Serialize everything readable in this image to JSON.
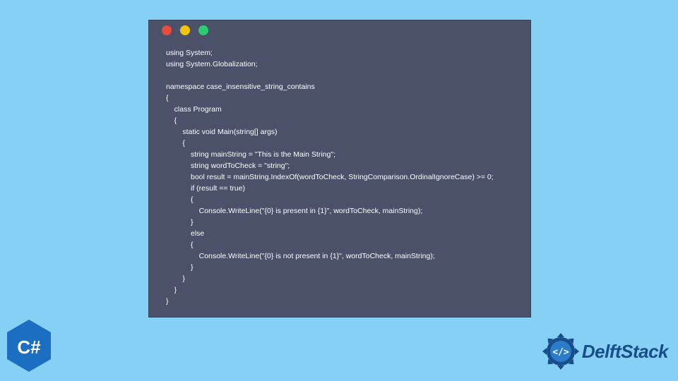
{
  "window": {
    "dots": {
      "red": "#e74c3c",
      "yellow": "#f1c40f",
      "green": "#2ecc71"
    }
  },
  "code": "using System;\nusing System.Globalization;\n\nnamespace case_insensitive_string_contains\n{\n    class Program\n    {\n        static void Main(string[] args)\n        {\n            string mainString = \"This is the Main String\";\n            string wordToCheck = \"string\";\n            bool result = mainString.IndexOf(wordToCheck, StringComparison.OrdinalIgnoreCase) >= 0;\n            if (result == true)\n            {\n                Console.WriteLine(\"{0} is present in {1}\", wordToCheck, mainString);\n            }\n            else\n            {\n                Console.WriteLine(\"{0} is not present in {1}\", wordToCheck, mainString);\n            }\n        }\n    }\n}",
  "brand": {
    "delft_text": "DelftStack",
    "csharp_label": "C#"
  },
  "colors": {
    "page_bg": "#87d0f5",
    "window_bg": "#4a5169",
    "csharp_color": "#1b6ec2",
    "delft_color": "#174d8a"
  }
}
